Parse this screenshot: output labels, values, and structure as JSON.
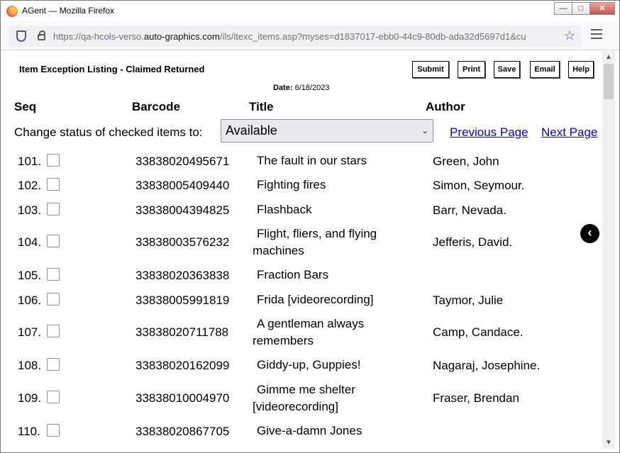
{
  "window": {
    "title": "AGent — Mozilla Firefox",
    "min": "—",
    "max": "□",
    "close": "✕"
  },
  "browser": {
    "url_prefix": "https://qa-hcols-verso.",
    "url_domain": "auto-graphics.com",
    "url_suffix": "/ils/itexc_items.asp?myses=d1837017-ebb0-44c9-80db-ada32d5697d1&cu",
    "star_icon": "☆"
  },
  "page": {
    "title": "Item Exception Listing - Claimed Returned",
    "buttons": {
      "submit": "Submit",
      "print": "Print",
      "save": "Save",
      "email": "Email",
      "help": "Help"
    },
    "date_label": "Date:",
    "date_value": "6/18/2023",
    "columns": {
      "seq": "Seq",
      "barcode": "Barcode",
      "title": "Title",
      "author": "Author"
    },
    "change_label": "Change status of checked items to:",
    "status_selected": "Available",
    "prev_page": "Previous Page",
    "next_page": "Next Page",
    "back_icon": "‹"
  },
  "rows": [
    {
      "seq": "101.",
      "barcode": "33838020495671",
      "title": "The fault in our stars",
      "author": "Green, John"
    },
    {
      "seq": "102.",
      "barcode": "33838005409440",
      "title": "Fighting fires",
      "author": "Simon, Seymour."
    },
    {
      "seq": "103.",
      "barcode": "33838004394825",
      "title": "Flashback",
      "author": "Barr, Nevada."
    },
    {
      "seq": "104.",
      "barcode": "33838003576232",
      "title": "Flight, fliers, and flying machines",
      "author": "Jefferis, David."
    },
    {
      "seq": "105.",
      "barcode": "33838020363838",
      "title": "Fraction Bars",
      "author": ""
    },
    {
      "seq": "106.",
      "barcode": "33838005991819",
      "title": "Frida [videorecording]",
      "author": "Taymor, Julie"
    },
    {
      "seq": "107.",
      "barcode": "33838020711788",
      "title": "A gentleman always remembers",
      "author": "Camp, Candace."
    },
    {
      "seq": "108.",
      "barcode": "33838020162099",
      "title": "Giddy-up, Guppies!",
      "author": "Nagaraj, Josephine."
    },
    {
      "seq": "109.",
      "barcode": "33838010004970",
      "title": "Gimme me shelter [videorecording]",
      "author": "Fraser, Brendan"
    },
    {
      "seq": "110.",
      "barcode": "33838020867705",
      "title": "Give-a-damn Jones",
      "author": ""
    }
  ]
}
